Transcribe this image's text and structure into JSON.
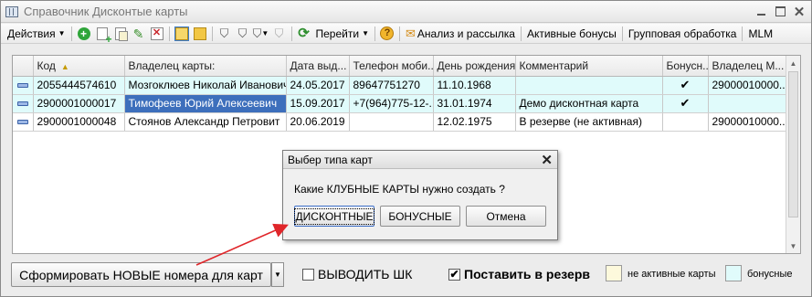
{
  "window": {
    "title": "Справочник  Дисконтые карты"
  },
  "toolbar": {
    "actions_label": "Действия",
    "goto_label": "Перейти",
    "analysis_label": "Анализ и рассылка",
    "active_bonuses_label": "Активные бонусы",
    "group_processing_label": "Групповая обработка",
    "mlm_label": "MLM"
  },
  "table": {
    "columns": [
      "",
      "Код",
      "Владелец карты:",
      "Дата выд...",
      "Телефон моби...",
      "День рождения",
      "Комментарий",
      "Бонусн...",
      "Владелец М..."
    ],
    "rows": [
      {
        "code": "2055444574610",
        "owner": "Мозгоклюев Николай Иванович",
        "issue_date": "24.05.2017",
        "phone": "89647751270",
        "birthday": "11.10.1968",
        "comment": "",
        "bonus": "✔",
        "mlm_owner": "29000010000...",
        "style": "bonus"
      },
      {
        "code": "2900001000017",
        "owner": "Тимофеев Юрий Алексеевич",
        "issue_date": "15.09.2017",
        "phone": "+7(964)775-12-...",
        "birthday": "31.01.1974",
        "comment": "Демо дисконтная карта",
        "bonus": "✔",
        "mlm_owner": "",
        "style": "bonus"
      },
      {
        "code": "2900001000048",
        "owner": "Стоянов Александр Петровит",
        "issue_date": "20.06.2019",
        "phone": "",
        "birthday": "12.02.1975",
        "comment": "В резерве (не активная)",
        "bonus": "",
        "mlm_owner": "29000010000...",
        "style": "plain"
      }
    ]
  },
  "dialog": {
    "title": "Выбер типа карт",
    "question": "Какие КЛУБНЫЕ КАРТЫ нужно создать ?",
    "discount_button": "ДИСКОНТНЫЕ",
    "bonus_button": "БОНУСНЫЕ",
    "cancel_button": "Отмена"
  },
  "bottom": {
    "generate_button": "Сформировать НОВЫЕ номера для карт",
    "print_barcode_label": "ВЫВОДИТЬ ШК",
    "print_barcode_checked": false,
    "reserve_label": "Поставить в резерв",
    "reserve_checked": true,
    "legend_inactive": "не активные карты",
    "legend_bonus": "бонусные"
  },
  "colors": {
    "inactive_card": "#fdf9dc",
    "bonus_card": "#e0fbfb",
    "selection": "#3d6fbc",
    "annotation_arrow": "#e0262a"
  }
}
